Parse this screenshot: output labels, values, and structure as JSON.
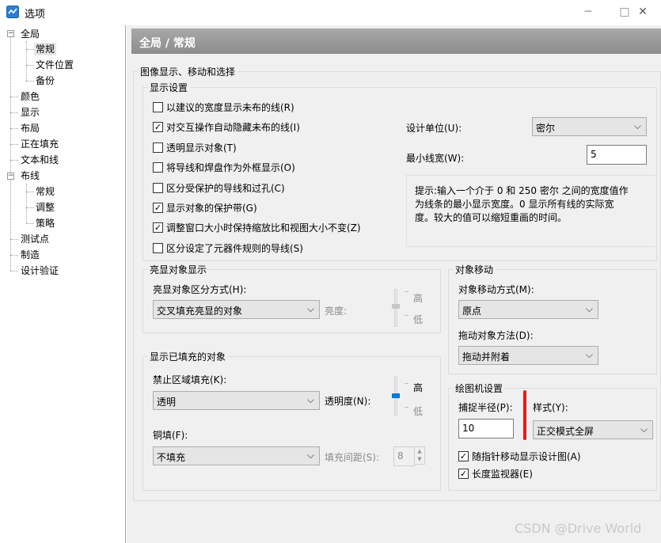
{
  "window": {
    "title": "选项",
    "minimize": "─",
    "maximize": "□",
    "close": "✕"
  },
  "tree": {
    "items": [
      {
        "label": "全局",
        "level": 0,
        "toggle": "−"
      },
      {
        "label": "常规",
        "level": 1,
        "selected": true
      },
      {
        "label": "文件位置",
        "level": 1
      },
      {
        "label": "备份",
        "level": 1
      },
      {
        "label": "颜色",
        "level": 0
      },
      {
        "label": "显示",
        "level": 0
      },
      {
        "label": "布局",
        "level": 0
      },
      {
        "label": "正在填充",
        "level": 0
      },
      {
        "label": "文本和线",
        "level": 0
      },
      {
        "label": "布线",
        "level": 0,
        "toggle": "−"
      },
      {
        "label": "常规",
        "level": 1
      },
      {
        "label": "调整",
        "level": 1
      },
      {
        "label": "策略",
        "level": 1
      },
      {
        "label": "测试点",
        "level": 0
      },
      {
        "label": "制造",
        "level": 0
      },
      {
        "label": "设计验证",
        "level": 0
      }
    ]
  },
  "header": {
    "title": "全局 / 常规"
  },
  "image_group": {
    "title": "图像显示、移动和选择"
  },
  "display_settings": {
    "title": "显示设置",
    "checkboxes": [
      {
        "label": "以建议的宽度显示未布的线(R)",
        "checked": false
      },
      {
        "label": "对交互操作自动隐藏未布的线(I)",
        "checked": true
      },
      {
        "label": "透明显示对象(T)",
        "checked": false
      },
      {
        "label": "将导线和焊盘作为外框显示(O)",
        "checked": false
      },
      {
        "label": "区分受保护的导线和过孔(C)",
        "checked": false
      },
      {
        "label": "显示对象的保护带(G)",
        "checked": true
      },
      {
        "label": "调整窗口大小时保持缩放比和视图大小不变(Z)",
        "checked": true
      },
      {
        "label": "区分设定了元器件规则的导线(S)",
        "checked": false
      }
    ],
    "design_unit_label": "设计单位(U):",
    "design_unit_value": "密尔",
    "min_width_label": "最小线宽(W):",
    "min_width_value": "5",
    "hint": "提示:输入一个介于 0 和 250 密尔 之间的宽度值作为线条的最小显示宽度。0 显示所有线的实际宽度。较大的值可以缩短重画的时间。"
  },
  "highlight": {
    "title": "亮显对象显示",
    "mode_label": "亮显对象区分方式(H):",
    "mode_value": "交叉填充亮显的对象",
    "brightness_label": "亮度:",
    "high": "高",
    "low": "低"
  },
  "object_move": {
    "title": "对象移动",
    "move_label": "对象移动方式(M):",
    "move_value": "原点",
    "drag_label": "拖动对象方法(D):",
    "drag_value": "拖动并附着"
  },
  "filled_objects": {
    "title": "显示已填充的对象",
    "keepout_label": "禁止区域填充(K):",
    "keepout_value": "透明",
    "transparency_label": "透明度(N):",
    "high": "高",
    "low": "低",
    "transparency_level": 0.35,
    "copper_label": "铜填(F):",
    "copper_value": "不填充",
    "fill_spacing_label": "填充间距(S):",
    "fill_spacing_value": "8"
  },
  "drawing_settings": {
    "title": "绘图机设置",
    "snap_radius_label": "捕捉半径(P):",
    "snap_radius_value": "10",
    "style_label": "样式(Y):",
    "style_value": "正交模式全屏",
    "checkboxes": [
      {
        "label": "随指针移动显示设计图(A)",
        "checked": true
      },
      {
        "label": "长度监视器(E)",
        "checked": true
      }
    ]
  },
  "watermark": "CSDN @Drive World",
  "colors": {
    "accent": "#0078d7",
    "highlight_box": "#e21b1b",
    "header": "#999999"
  }
}
